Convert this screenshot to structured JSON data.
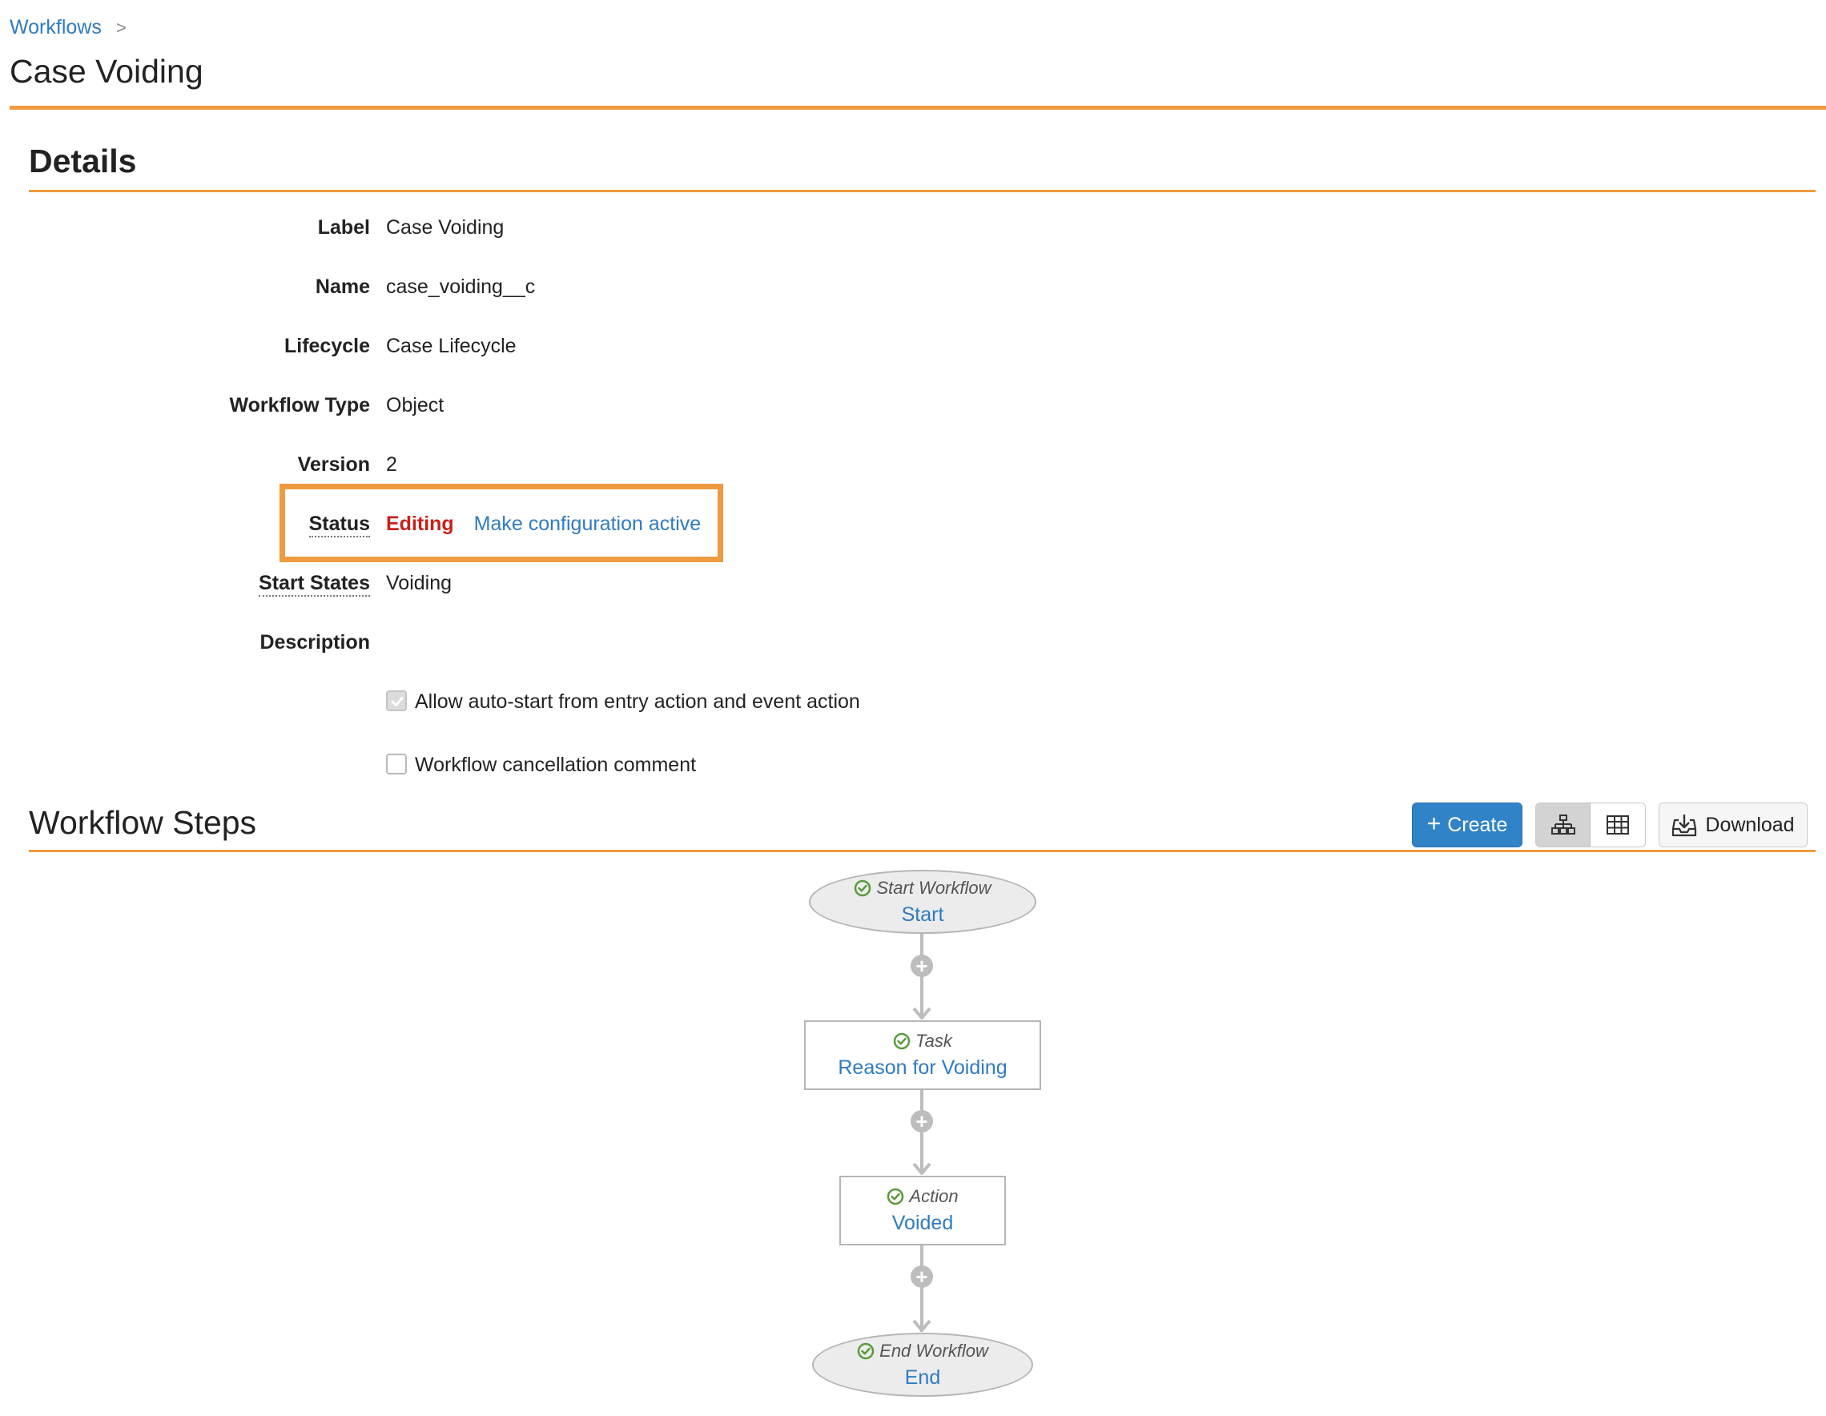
{
  "breadcrumb": {
    "parent": "Workflows",
    "separator": ">"
  },
  "page": {
    "title": "Case Voiding"
  },
  "details": {
    "section_title": "Details",
    "fields": {
      "label": {
        "label": "Label",
        "value": "Case Voiding"
      },
      "name": {
        "label": "Name",
        "value": "case_voiding__c"
      },
      "lifecycle": {
        "label": "Lifecycle",
        "value": "Case Lifecycle"
      },
      "workflow_type": {
        "label": "Workflow Type",
        "value": "Object"
      },
      "version": {
        "label": "Version",
        "value": "2"
      },
      "status": {
        "label": "Status",
        "value": "Editing",
        "action": "Make configuration active"
      },
      "start_states": {
        "label": "Start States",
        "value": "Voiding"
      },
      "description": {
        "label": "Description",
        "value": ""
      }
    },
    "options": {
      "auto_start": {
        "label": "Allow auto-start from entry action and event action",
        "checked": true
      },
      "cancellation_comment": {
        "label": "Workflow cancellation comment",
        "checked": false
      }
    }
  },
  "steps": {
    "section_title": "Workflow Steps",
    "create_label": "Create",
    "download_label": "Download",
    "nodes": [
      {
        "type": "Start Workflow",
        "name": "Start"
      },
      {
        "type": "Task",
        "name": "Reason for Voiding"
      },
      {
        "type": "Action",
        "name": "Voided"
      },
      {
        "type": "End Workflow",
        "name": "End"
      }
    ]
  },
  "colors": {
    "accent": "#ef9a3e",
    "link": "#2f7bbf",
    "primary_button": "#3183c8",
    "editing_status": "#c8211b",
    "check_icon": "#5a9a3a"
  },
  "icons": {
    "tree_view": "hierarchy-icon",
    "table_view": "grid-icon",
    "download": "download-icon",
    "step_status": "check-circle-icon",
    "add_step": "plus-circle-icon"
  }
}
